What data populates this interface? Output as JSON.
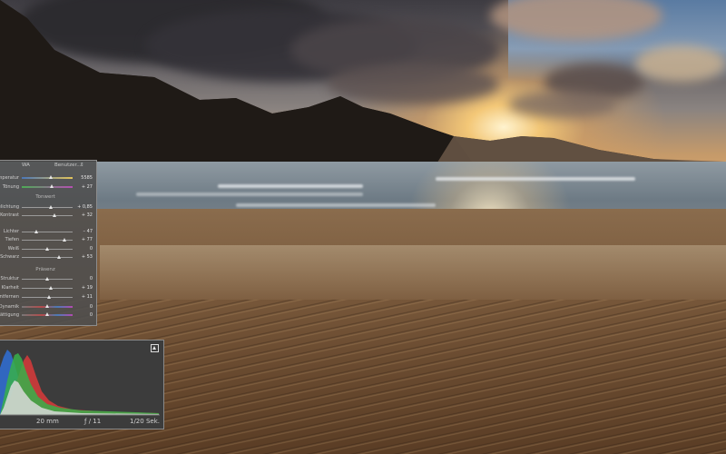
{
  "panel": {
    "header_left": "WA",
    "header_profile": "Benutzer...",
    "header_dropdown_icon": "dropdown-arrow-icon",
    "sections": [
      {
        "title": "",
        "rows": [
          {
            "label": "Temperatur",
            "value": "5585",
            "pos": 0.58,
            "track": "temp"
          },
          {
            "label": "Tönung",
            "value": "+ 27",
            "pos": 0.6,
            "track": "tint"
          }
        ]
      },
      {
        "title": "Tonwert",
        "rows": [
          {
            "label": "Belichtung",
            "value": "+ 0,85",
            "pos": 0.58,
            "track": ""
          },
          {
            "label": "Kontrast",
            "value": "+ 32",
            "pos": 0.66,
            "track": ""
          }
        ]
      },
      {
        "title": "",
        "rows": [
          {
            "label": "Lichter",
            "value": "– 47",
            "pos": 0.3,
            "track": ""
          },
          {
            "label": "Tiefen",
            "value": "+ 77",
            "pos": 0.85,
            "track": ""
          },
          {
            "label": "Weiß",
            "value": "0",
            "pos": 0.5,
            "track": ""
          },
          {
            "label": "Schwarz",
            "value": "+ 53",
            "pos": 0.74,
            "track": ""
          }
        ]
      },
      {
        "title": "Präsenz",
        "rows": [
          {
            "label": "Struktur",
            "value": "0",
            "pos": 0.5,
            "track": ""
          },
          {
            "label": "Klarheit",
            "value": "+ 19",
            "pos": 0.58,
            "track": ""
          },
          {
            "label": "Dunst entfernen",
            "value": "+ 11",
            "pos": 0.55,
            "track": ""
          },
          {
            "label": "Dynamik",
            "value": "0",
            "pos": 0.5,
            "track": "vib"
          },
          {
            "label": "Sättigung",
            "value": "0",
            "pos": 0.5,
            "track": "vib"
          }
        ]
      }
    ]
  },
  "histogram": {
    "focal_length": "20 mm",
    "aperture": "ƒ / 11",
    "shutter": "1/20 Sek.",
    "clipping_icon": "highlight-clipping-icon",
    "channel_colors": {
      "red": "#d83a3a",
      "green": "#37b04a",
      "blue": "#2f6fd6",
      "luma": "#d9d9d9"
    }
  },
  "colors": {
    "panel_bg": "#4e4e4e",
    "panel_border": "#8c8c8c"
  }
}
